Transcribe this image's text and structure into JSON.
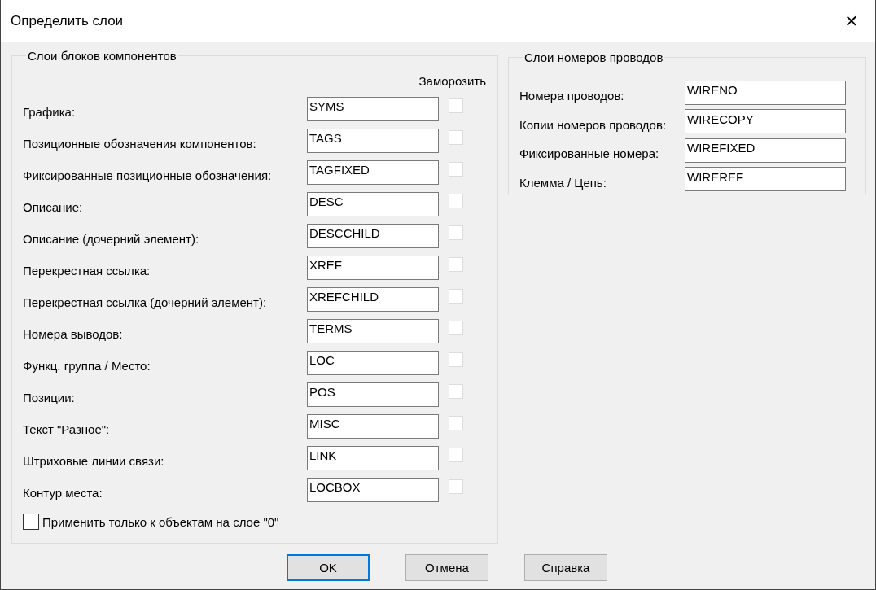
{
  "window": {
    "title": "Определить слои",
    "close": "✕"
  },
  "component_layers": {
    "title": "Слои блоков компонентов",
    "freeze_header": "Заморозить",
    "rows": [
      {
        "label": "Графика:",
        "value": "SYMS",
        "frozen": false,
        "disabled": true
      },
      {
        "label": "Позиционные обозначения компонентов:",
        "value": "TAGS",
        "frozen": false,
        "disabled": true
      },
      {
        "label": "Фиксированные позиционные обозначения:",
        "value": "TAGFIXED",
        "frozen": false,
        "disabled": true
      },
      {
        "label": "Описание:",
        "value": "DESC",
        "frozen": false,
        "disabled": true
      },
      {
        "label": "Описание (дочерний элемент):",
        "value": "DESCCHILD",
        "frozen": false,
        "disabled": true
      },
      {
        "label": "Перекрестная ссылка:",
        "value": "XREF",
        "frozen": false,
        "disabled": true
      },
      {
        "label": "Перекрестная ссылка (дочерний элемент):",
        "value": "XREFCHILD",
        "frozen": false,
        "disabled": true
      },
      {
        "label": "Номера выводов:",
        "value": "TERMS",
        "frozen": false,
        "disabled": true
      },
      {
        "label": "Функц. группа / Место:",
        "value": "LOC",
        "frozen": false,
        "disabled": true
      },
      {
        "label": "Позиции:",
        "value": "POS",
        "frozen": false,
        "disabled": true
      },
      {
        "label": "Текст \"Разное\":",
        "value": "MISC",
        "frozen": false,
        "disabled": true
      },
      {
        "label": "Штриховые линии связи:",
        "value": "LINK",
        "frozen": false,
        "disabled": true
      },
      {
        "label": "Контур места:",
        "value": "LOCBOX",
        "frozen": false,
        "disabled": true
      }
    ],
    "apply_only": {
      "label": "Применить только к объектам на слое \"0\"",
      "checked": false
    }
  },
  "wire_layers": {
    "title": "Слои номеров проводов",
    "rows": [
      {
        "label": "Номера проводов:",
        "value": "WIRENO"
      },
      {
        "label": "Копии номеров проводов:",
        "value": "WIRECOPY"
      },
      {
        "label": "Фиксированные номера:",
        "value": "WIREFIXED"
      },
      {
        "label": "Клемма / Цепь:",
        "value": "WIREREF"
      }
    ]
  },
  "buttons": [
    {
      "label": "OK",
      "default": true
    },
    {
      "label": "Отмена",
      "default": false
    },
    {
      "label": "Справка",
      "default": false
    }
  ]
}
